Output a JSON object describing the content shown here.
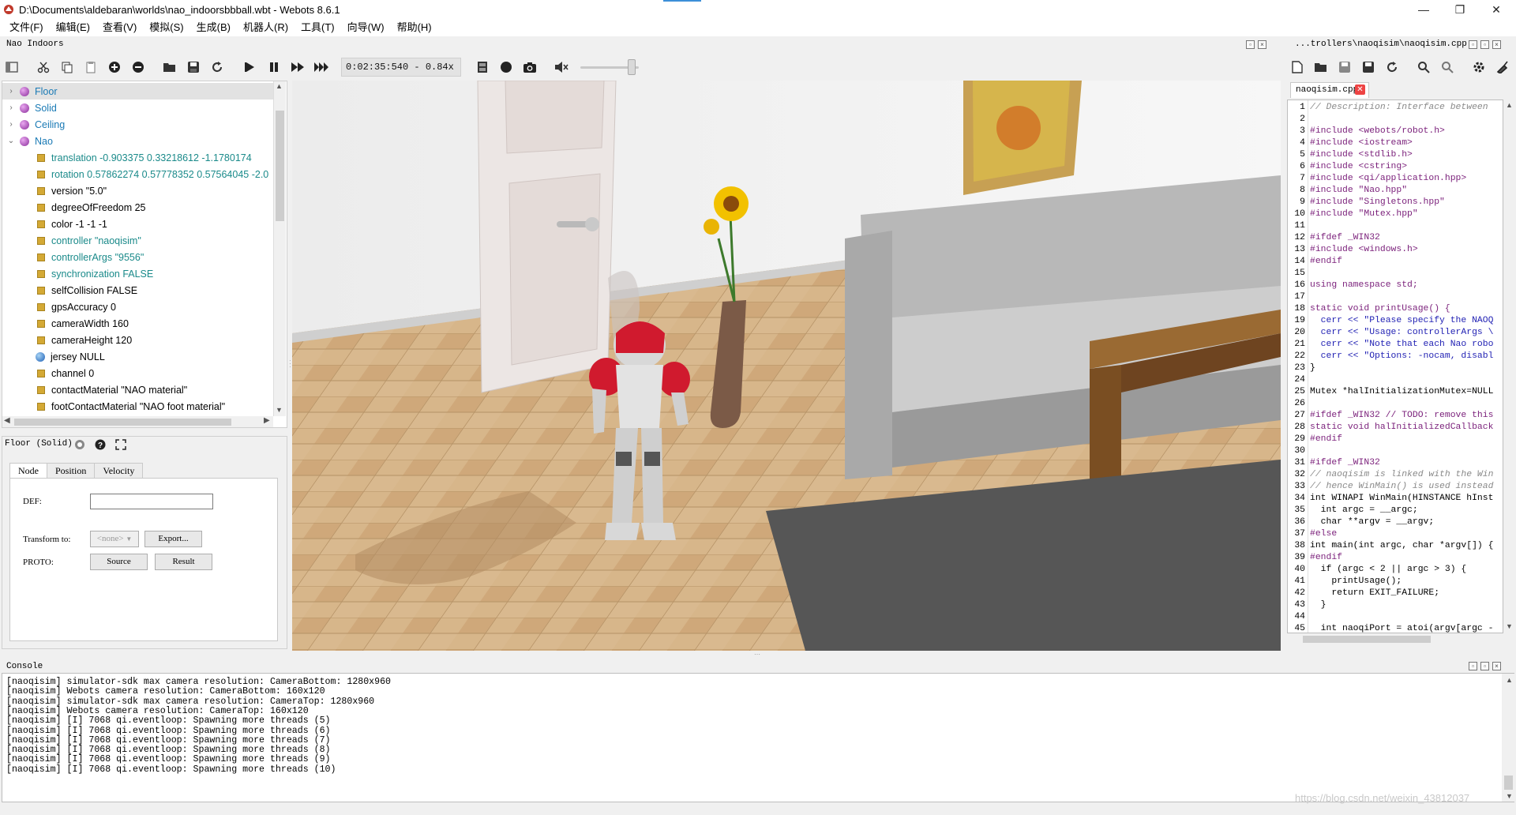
{
  "window": {
    "title": "D:\\Documents\\aldebaran\\worlds\\nao_indoorsbbball.wbt - Webots 8.6.1",
    "min": "—",
    "max": "❐",
    "close": "✕"
  },
  "menu": [
    "文件(F)",
    "编辑(E)",
    "查看(V)",
    "模拟(S)",
    "生成(B)",
    "机器人(R)",
    "工具(T)",
    "向导(W)",
    "帮助(H)"
  ],
  "scene_panel": {
    "title": "Nao Indoors",
    "time": "0:02:35:540  -  0.84x"
  },
  "scene_tree": [
    {
      "label": "Floor",
      "kind": "node",
      "color": "#1a7ab5",
      "expanded": false
    },
    {
      "label": "Solid",
      "kind": "node",
      "color": "#1a7ab5",
      "expanded": false
    },
    {
      "label": "Ceiling",
      "kind": "node",
      "color": "#1a7ab5",
      "expanded": false
    },
    {
      "label": "Nao",
      "kind": "node",
      "color": "#1a7ab5",
      "expanded": true
    },
    {
      "label": "translation -0.903375 0.33218612 -1.1780174",
      "kind": "field",
      "color": "#1a8a8a"
    },
    {
      "label": "rotation 0.57862274 0.57778352 0.57564045 -2.0",
      "kind": "field",
      "color": "#1a8a8a"
    },
    {
      "label": "version \"5.0\"",
      "kind": "field",
      "color": "#000000"
    },
    {
      "label": "degreeOfFreedom 25",
      "kind": "field",
      "color": "#000000"
    },
    {
      "label": "color -1 -1 -1",
      "kind": "field",
      "color": "#000000"
    },
    {
      "label": "controller \"naoqisim\"",
      "kind": "field",
      "color": "#1a8a8a"
    },
    {
      "label": "controllerArgs \"9556\"",
      "kind": "field",
      "color": "#1a8a8a"
    },
    {
      "label": "synchronization FALSE",
      "kind": "field",
      "color": "#1a8a8a"
    },
    {
      "label": "selfCollision FALSE",
      "kind": "field",
      "color": "#000000"
    },
    {
      "label": "gpsAccuracy 0",
      "kind": "field",
      "color": "#000000"
    },
    {
      "label": "cameraWidth 160",
      "kind": "field",
      "color": "#000000"
    },
    {
      "label": "cameraHeight 120",
      "kind": "field",
      "color": "#000000"
    },
    {
      "label": "jersey NULL",
      "kind": "nodefield",
      "color": "#000000"
    },
    {
      "label": "channel 0",
      "kind": "field",
      "color": "#000000"
    },
    {
      "label": "contactMaterial \"NAO material\"",
      "kind": "field",
      "color": "#000000"
    },
    {
      "label": "footContactMaterial \"NAO foot material\"",
      "kind": "field",
      "color": "#000000"
    }
  ],
  "field_editor": {
    "title": "Floor (Solid)",
    "tabs": [
      "Node",
      "Position",
      "Velocity"
    ],
    "def_label": "DEF:",
    "def_value": "",
    "transform_label": "Transform to:",
    "transform_value": "<none>",
    "export_label": "Export...",
    "proto_label": "PROTO:",
    "source_label": "Source",
    "result_label": "Result"
  },
  "editor": {
    "title": "...trollers\\naoqisim\\naoqisim.cpp",
    "tab": "naoqisim.cpp",
    "lines": [
      {
        "n": "1",
        "t": "// Description: Interface between ",
        "c": "cm"
      },
      {
        "n": "2",
        "t": "",
        "c": ""
      },
      {
        "n": "3",
        "t": "#include <webots/robot.h>",
        "c": "pp"
      },
      {
        "n": "4",
        "t": "#include <iostream>",
        "c": "pp"
      },
      {
        "n": "5",
        "t": "#include <stdlib.h>",
        "c": "pp"
      },
      {
        "n": "6",
        "t": "#include <cstring>",
        "c": "pp"
      },
      {
        "n": "7",
        "t": "#include <qi/application.hpp>",
        "c": "pp"
      },
      {
        "n": "8",
        "t": "#include \"Nao.hpp\"",
        "c": "pp"
      },
      {
        "n": "9",
        "t": "#include \"Singletons.hpp\"",
        "c": "pp"
      },
      {
        "n": "10",
        "t": "#include \"Mutex.hpp\"",
        "c": "pp"
      },
      {
        "n": "11",
        "t": "",
        "c": ""
      },
      {
        "n": "12",
        "t": "#ifdef _WIN32",
        "c": "pp"
      },
      {
        "n": "13",
        "t": "#include <windows.h>",
        "c": "pp"
      },
      {
        "n": "14",
        "t": "#endif",
        "c": "pp"
      },
      {
        "n": "15",
        "t": "",
        "c": ""
      },
      {
        "n": "16",
        "t": "using namespace std;",
        "c": "kw"
      },
      {
        "n": "17",
        "t": "",
        "c": ""
      },
      {
        "n": "18",
        "t": "static void printUsage() {",
        "c": "kw"
      },
      {
        "n": "19",
        "t": "  cerr << \"Please specify the NAOQ",
        "c": "st"
      },
      {
        "n": "20",
        "t": "  cerr << \"Usage: controllerArgs \\",
        "c": "st"
      },
      {
        "n": "21",
        "t": "  cerr << \"Note that each Nao robo",
        "c": "st"
      },
      {
        "n": "22",
        "t": "  cerr << \"Options: -nocam, disabl",
        "c": "st"
      },
      {
        "n": "23",
        "t": "}",
        "c": ""
      },
      {
        "n": "24",
        "t": "",
        "c": ""
      },
      {
        "n": "25",
        "t": "Mutex *halInitializationMutex=NULL",
        "c": ""
      },
      {
        "n": "26",
        "t": "",
        "c": ""
      },
      {
        "n": "27",
        "t": "#ifdef _WIN32 // TODO: remove this",
        "c": "pp"
      },
      {
        "n": "28",
        "t": "static void halInitializedCallback",
        "c": "kw"
      },
      {
        "n": "29",
        "t": "#endif",
        "c": "pp"
      },
      {
        "n": "30",
        "t": "",
        "c": ""
      },
      {
        "n": "31",
        "t": "#ifdef _WIN32",
        "c": "pp"
      },
      {
        "n": "32",
        "t": "// naoqisim is linked with the Win",
        "c": "cm"
      },
      {
        "n": "33",
        "t": "// hence WinMain() is used instead",
        "c": "cm"
      },
      {
        "n": "34",
        "t": "int WINAPI WinMain(HINSTANCE hInst",
        "c": ""
      },
      {
        "n": "35",
        "t": "  int argc = __argc;",
        "c": ""
      },
      {
        "n": "36",
        "t": "  char **argv = __argv;",
        "c": ""
      },
      {
        "n": "37",
        "t": "#else",
        "c": "pp"
      },
      {
        "n": "38",
        "t": "int main(int argc, char *argv[]) {",
        "c": ""
      },
      {
        "n": "39",
        "t": "#endif",
        "c": "pp"
      },
      {
        "n": "40",
        "t": "  if (argc < 2 || argc > 3) {",
        "c": ""
      },
      {
        "n": "41",
        "t": "    printUsage();",
        "c": ""
      },
      {
        "n": "42",
        "t": "    return EXIT_FAILURE;",
        "c": ""
      },
      {
        "n": "43",
        "t": "  }",
        "c": ""
      },
      {
        "n": "44",
        "t": "",
        "c": ""
      },
      {
        "n": "45",
        "t": "  int naoqiPort = atoi(argv[argc -",
        "c": ""
      }
    ]
  },
  "console": {
    "title": "Console",
    "lines": [
      "[naoqisim] simulator-sdk max camera resolution: CameraBottom: 1280x960",
      "[naoqisim] Webots camera resolution: CameraBottom: 160x120",
      "[naoqisim] simulator-sdk max camera resolution: CameraTop: 1280x960",
      "[naoqisim] Webots camera resolution: CameraTop: 160x120",
      "[naoqisim] [I] 7068 qi.eventloop: Spawning more threads (5)",
      "[naoqisim] [I] 7068 qi.eventloop: Spawning more threads (6)",
      "[naoqisim] [I] 7068 qi.eventloop: Spawning more threads (7)",
      "[naoqisim] [I] 7068 qi.eventloop: Spawning more threads (8)",
      "[naoqisim] [I] 7068 qi.eventloop: Spawning more threads (9)",
      "[naoqisim] [I] 7068 qi.eventloop: Spawning more threads (10)"
    ]
  },
  "watermark": "https://blog.csdn.net/weixin_43812037"
}
